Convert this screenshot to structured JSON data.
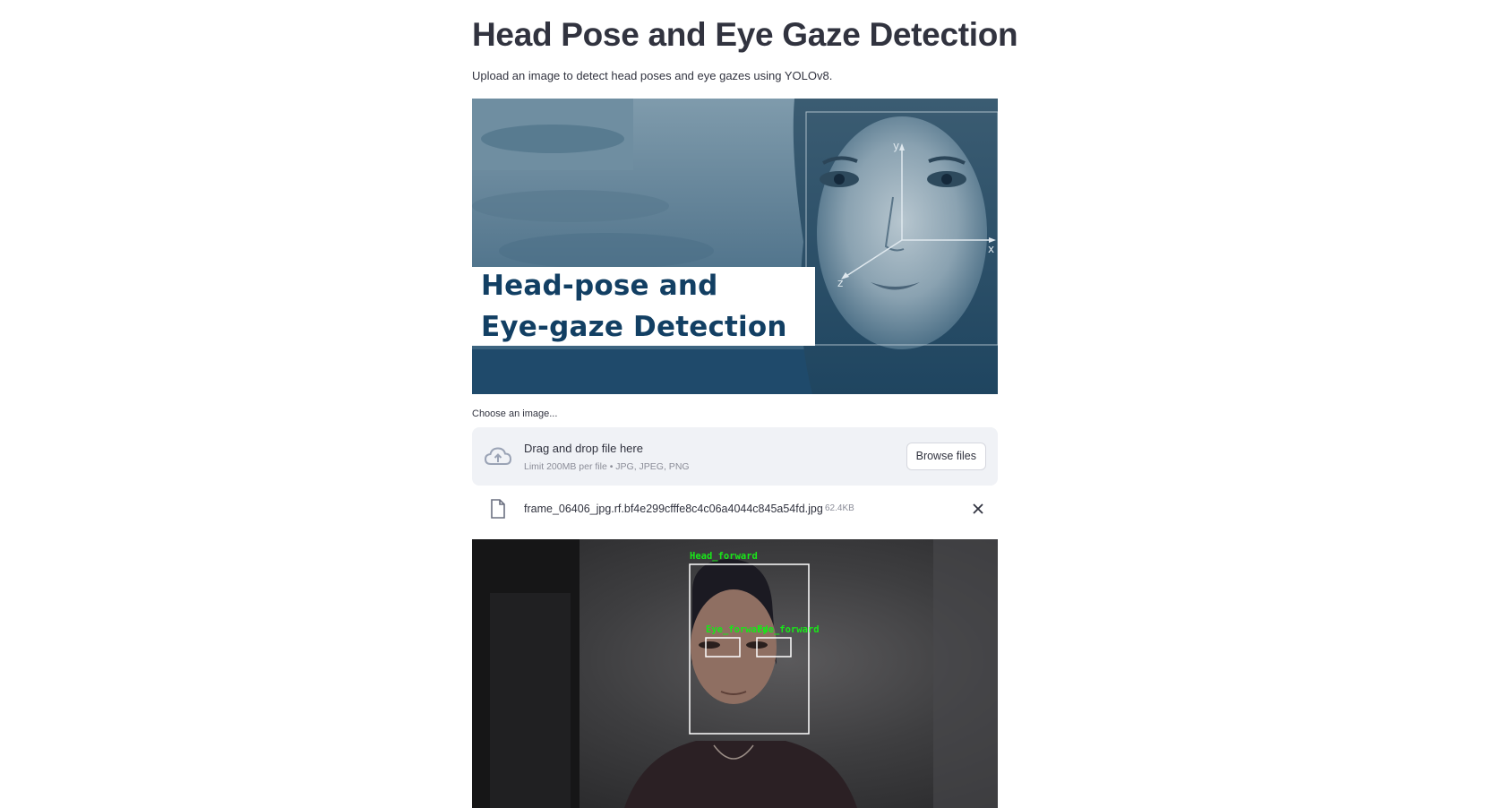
{
  "page": {
    "title": "Head Pose and Eye Gaze Detection",
    "subtitle": "Upload an image to detect head poses and eye gazes using YOLOv8."
  },
  "banner": {
    "line1": "Head-pose and",
    "line2": "Eye-gaze Detection",
    "axis_labels": {
      "y": "y",
      "x": "x",
      "z": "z"
    }
  },
  "uploader": {
    "label": "Choose an image...",
    "dropzone_title": "Drag and drop file here",
    "dropzone_limit": "Limit 200MB per file • JPG, JPEG, PNG",
    "browse_label": "Browse files",
    "upload_icon": "cloud-upload-icon"
  },
  "uploaded_file": {
    "name": "frame_06406_jpg.rf.bf4e299cfffe8c4c06a4044c845a54fd.jpg",
    "size": "62.4KB",
    "file_icon": "file-icon",
    "remove_icon": "close-icon"
  },
  "result": {
    "detections": [
      {
        "label": "Head_forward"
      },
      {
        "label": "Eye_forward"
      },
      {
        "label": "Eye_forward"
      }
    ],
    "colors": {
      "label": "#19e619",
      "box": "#ffffff"
    }
  }
}
